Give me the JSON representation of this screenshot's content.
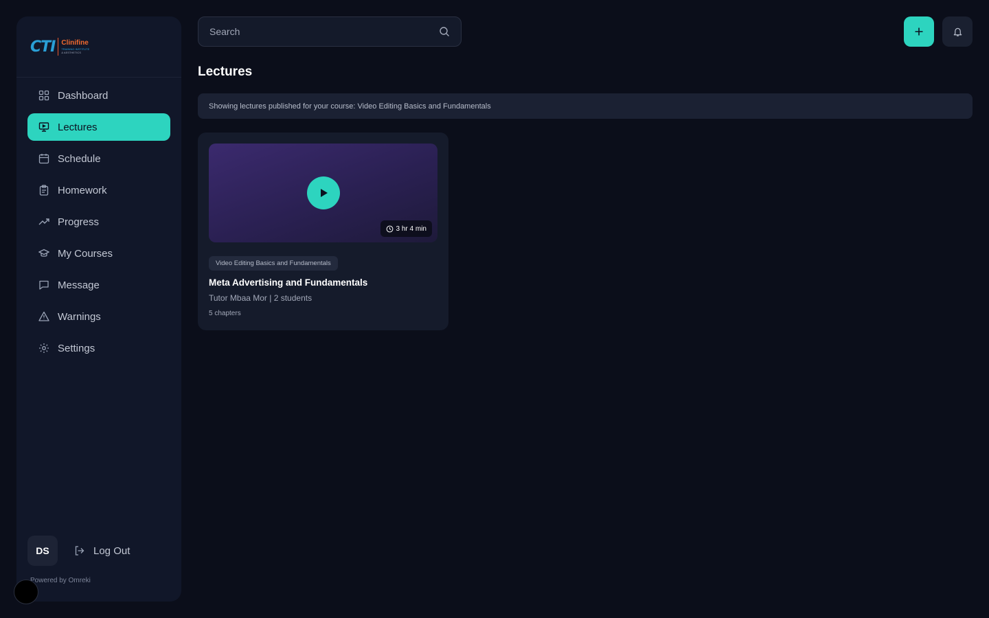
{
  "brand": {
    "logo_mark": "CTI",
    "logo_name": "Clinifine",
    "logo_sub": "TRAINING INSTITUTE",
    "logo_sub2": "& AESTHETICS"
  },
  "sidebar": {
    "items": [
      {
        "label": "Dashboard",
        "icon": "grid-icon"
      },
      {
        "label": "Lectures",
        "icon": "presentation-icon",
        "active": true
      },
      {
        "label": "Schedule",
        "icon": "calendar-icon"
      },
      {
        "label": "Homework",
        "icon": "clipboard-icon"
      },
      {
        "label": "Progress",
        "icon": "trending-up-icon"
      },
      {
        "label": "My Courses",
        "icon": "graduation-cap-icon"
      },
      {
        "label": "Message",
        "icon": "message-icon"
      },
      {
        "label": "Warnings",
        "icon": "warning-icon"
      },
      {
        "label": "Settings",
        "icon": "gear-icon"
      }
    ],
    "user_initials": "DS",
    "logout_label": "Log Out",
    "powered_by": "Powered by Omreki"
  },
  "search": {
    "placeholder": "Search"
  },
  "page": {
    "title": "Lectures",
    "info": "Showing lectures published for your course: Video Editing Basics and Fundamentals"
  },
  "lectures": [
    {
      "duration": "3 hr 4 min",
      "tag": "Video Editing Basics and Fundamentals",
      "title": "Meta Advertising and Fundamentals",
      "meta": "Tutor Mbaa Mor | 2 students",
      "chapters": "5 chapters"
    }
  ],
  "colors": {
    "accent": "#2dd4bf",
    "background": "#0b0e1a",
    "sidebar": "#111729"
  }
}
